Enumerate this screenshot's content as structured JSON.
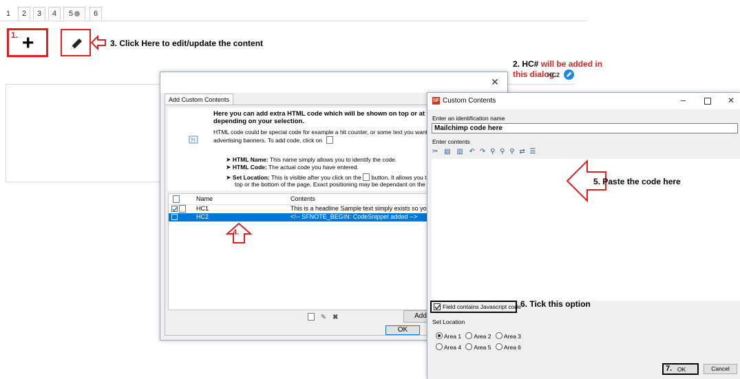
{
  "page_tabs": [
    "1",
    "2",
    "3",
    "4",
    "5",
    "6"
  ],
  "annotations": {
    "step1": "1.",
    "step3": "3. Click Here to edit/update the content",
    "step2_prefix": "2. HC#",
    "step2_rest": " will be added in",
    "step2_line2": "this dialog.",
    "step4": "4.",
    "step5": "5. Paste the code here",
    "step6": "6. Tick this option",
    "step7": "7."
  },
  "hc_badge": "HC2",
  "add_dialog": {
    "tab": "Add Custom Contents",
    "heading": "Here you can add extra HTML code which will be shown on top or at the bot",
    "heading2": "depending on your selection.",
    "para1": "HTML code could be special code for example a hit counter, or some text you want to d",
    "para2": "advertising banners. To add code, click on",
    "b1_label": "HTML Name:",
    "b1_text": " This name simply allows you to identify the code.",
    "b2_label": "HTML Code:",
    "b2_text": " The actual code you have entered.",
    "b3_label": "Set Location:",
    "b3_text": " This is visible after you click on the",
    "b3_text2": "button. It allows you to",
    "b3_line2": "top or the bottom of the page. Exact positioning may be dependant on the pag",
    "columns": [
      "Name",
      "Contents"
    ],
    "rows": [
      {
        "name": "HC1",
        "contents": "This is a headline Sample text simply exists so you ca"
      },
      {
        "name": "HC2",
        "contents": "<!-- SFNOTE_BEGIN: CodeSnippet added -->"
      }
    ],
    "add_button": "Add",
    "ok_button": "OK"
  },
  "custom_dialog": {
    "app_icon": "SF",
    "title": "Custom Contents",
    "name_label": "Enter an identification name",
    "name_value": "Mailchimp code here",
    "contents_label": "Enter contents",
    "js_checkbox": "Field contains Javascript code",
    "set_location": "Set Location",
    "areas": [
      "Area 1",
      "Area 2",
      "Area 3",
      "Area 4",
      "Area 5",
      "Area 6"
    ],
    "ok": "OK",
    "cancel": "Cancel"
  },
  "colors": {
    "annotation_red": "#e0201f",
    "selection_blue": "#0078d7"
  }
}
